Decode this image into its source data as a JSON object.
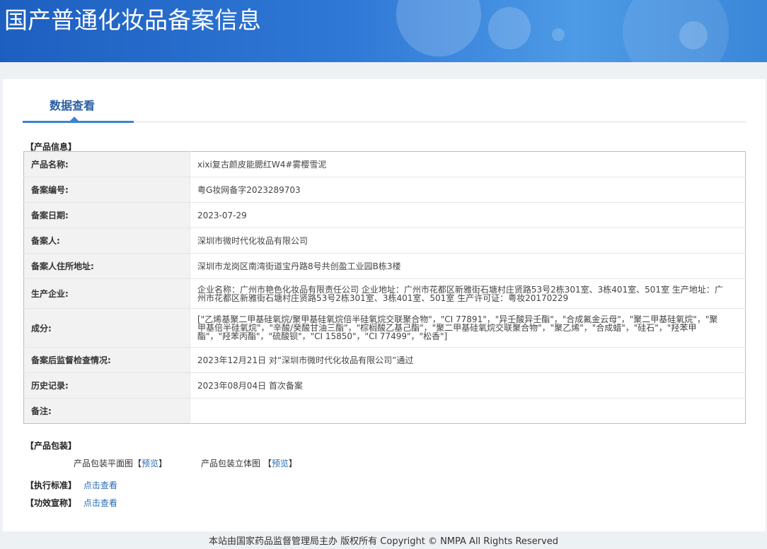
{
  "header": {
    "title": "国产普通化妆品备案信息"
  },
  "tabs": [
    {
      "label": "数据查看"
    }
  ],
  "product_info": {
    "section_label": "【产品信息】",
    "rows": [
      {
        "key": "产品名称:",
        "value": "xixi复古颜皮能腮红W4#雾樱雪泥"
      },
      {
        "key": "备案编号:",
        "value": "粤G妆网备字2023289703"
      },
      {
        "key": "备案日期:",
        "value": "2023-07-29"
      },
      {
        "key": "备案人:",
        "value": "深圳市微时代化妆品有限公司"
      },
      {
        "key": "备案人住所地址:",
        "value": "深圳市龙岗区南湾街道宝丹路8号共创盈工业园B栋3楼"
      },
      {
        "key": "生产企业:",
        "value": "企业名称：广州市艳色化妆品有限责任公司 企业地址：广州市花都区新雅街石塘村庄贤路53号2栋301室、3栋401室、501室 生产地址：广州市花都区新雅街石塘村庄贤路53号2栋301室、3栋401室、501室 生产许可证：粤妆20170229"
      },
      {
        "key": "成分:",
        "value": "[\"乙烯基聚二甲基硅氧烷/聚甲基硅氧烷倍半硅氧烷交联聚合物\"，\"CI 77891\"，\"异壬酸异壬酯\"，\"合成氟金云母\"，\"聚二甲基硅氧烷\"，\"聚甲基倍半硅氧烷\"，\"辛酸/癸酸甘油三酯\"，\"棕榈酸乙基己酯\"，\"聚二甲基硅氧烷交联聚合物\"，\"聚乙烯\"，\"合成蜡\"，\"硅石\"，\"羟苯甲酯\"，\"羟苯丙酯\"，\"硫酸钡\"，\"CI 15850\"，\"CI 77499\"，\"松香\"]"
      },
      {
        "key": "备案后监督检查情况:",
        "value": "2023年12月21日 对“深圳市微时代化妆品有限公司”通过"
      },
      {
        "key": "历史记录:",
        "value": "2023年08月04日 首次备案"
      },
      {
        "key": "备注:",
        "value": ""
      }
    ]
  },
  "packaging": {
    "section_label": "【产品包装】",
    "flat_label": "产品包装平面图",
    "solid_label": "产品包装立体图",
    "bracket_open": "【",
    "bracket_close": "】",
    "preview": "预览"
  },
  "standard": {
    "label": "【执行标准】",
    "link": "点击查看"
  },
  "efficacy": {
    "label": "【功效宣称】",
    "link": "点击查看"
  },
  "footer": {
    "text": "本站由国家药品监督管理局主办 版权所有 Copyright © NMPA All Rights Reserved"
  }
}
